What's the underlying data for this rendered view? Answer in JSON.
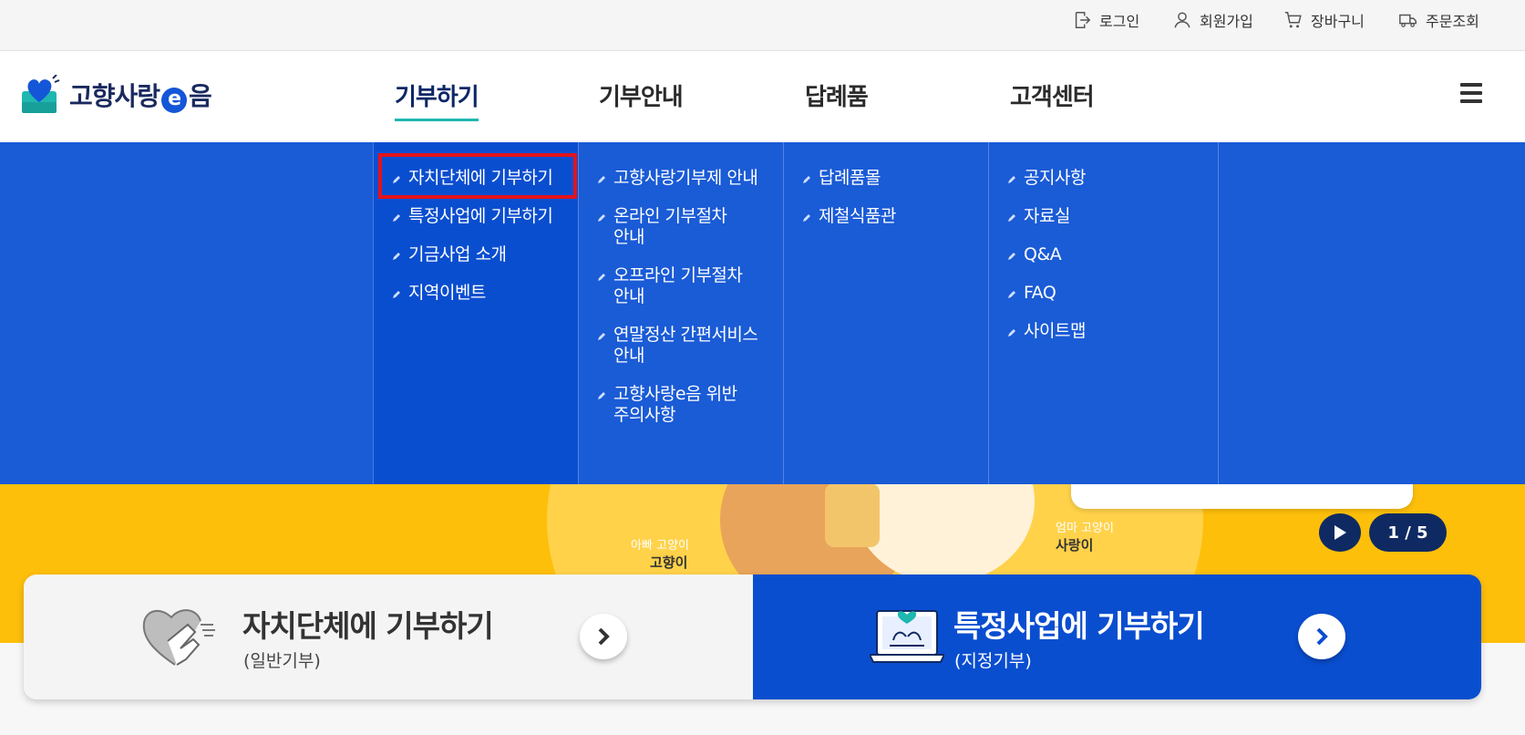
{
  "utility": {
    "login": "로그인",
    "signup": "회원가입",
    "cart": "장바구니",
    "order": "주문조회"
  },
  "logo": {
    "text_main": "고향사랑",
    "text_e": "e",
    "text_end": "음"
  },
  "gnb": [
    {
      "label": "기부하기"
    },
    {
      "label": "기부안내"
    },
    {
      "label": "답례품"
    },
    {
      "label": "고객센터"
    }
  ],
  "menu": {
    "col1": [
      "자치단체에 기부하기",
      "특정사업에 기부하기",
      "기금사업 소개",
      "지역이벤트"
    ],
    "col2": [
      "고향사랑기부제 안내",
      "온라인 기부절차 안내",
      "오프라인 기부절차 안내",
      "연말정산 간편서비스 안내",
      "고향사랑e음 위반 주의사항"
    ],
    "col3": [
      "답례품몰",
      "제철식품관"
    ],
    "col4": [
      "공지사항",
      "자료실",
      "Q&A",
      "FAQ",
      "사이트맵"
    ]
  },
  "hero": {
    "dad_label": "아빠 고양이",
    "dad_name": "고향이",
    "mom_label": "엄마 고양이",
    "mom_name": "사랑이",
    "pager": "1 / 5"
  },
  "cards": {
    "left_title": "자치단체에 기부하기",
    "left_sub": "(일반기부)",
    "right_title": "특정사업에 기부하기",
    "right_sub": "(지정기부)"
  },
  "colors": {
    "menu_blue": "#1a5bd6",
    "menu_blue_active": "#0a4ed0",
    "hero_yellow": "#fdbf0a",
    "navy": "#0f2a62",
    "highlight_red": "#e3131b"
  }
}
